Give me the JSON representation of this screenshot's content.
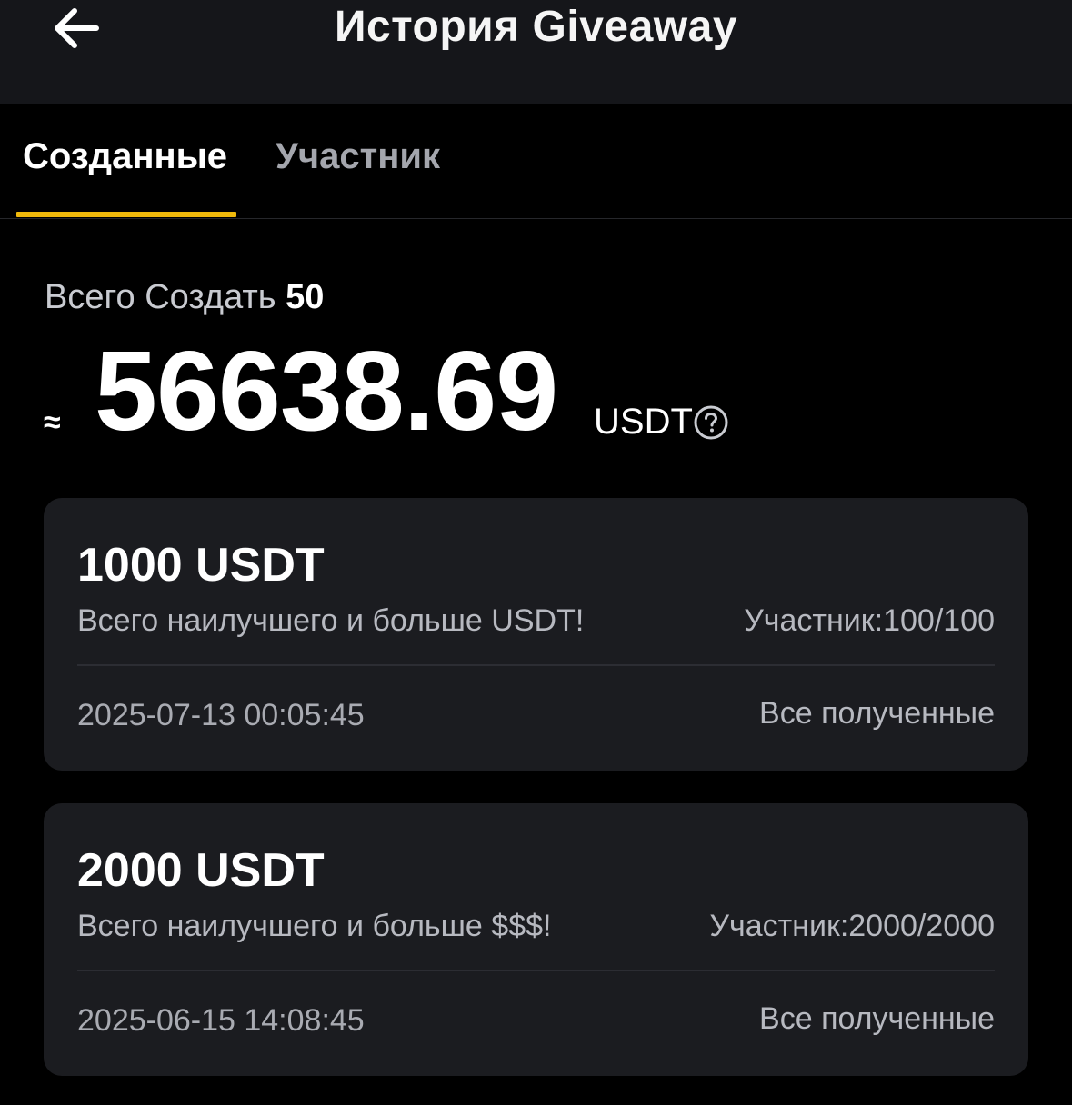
{
  "header": {
    "title": "История Giveaway",
    "back_icon": "arrow-left-icon"
  },
  "tabs": [
    {
      "label": "Созданные",
      "active": true
    },
    {
      "label": "Участник",
      "active": false
    }
  ],
  "colors": {
    "accent": "#f0b90b",
    "background": "#000000",
    "header_bg": "#15161a",
    "card_bg": "#1b1c20"
  },
  "summary": {
    "total_label": "Всего Создать",
    "total_count": "50",
    "approx_symbol": "≈",
    "amount": "56638.69",
    "unit": "USDT",
    "help_icon": "question-circle-icon"
  },
  "giveaways": [
    {
      "amount": "1000 USDT",
      "description": "Всего наилучшего и больше USDT!",
      "participants": "Участник:100/100",
      "date": "2025-07-13 00:05:45",
      "status": "Все полученные"
    },
    {
      "amount": "2000 USDT",
      "description": "Всего наилучшего и больше $$$!",
      "participants": "Участник:2000/2000",
      "date": "2025-06-15 14:08:45",
      "status": "Все полученные"
    }
  ]
}
